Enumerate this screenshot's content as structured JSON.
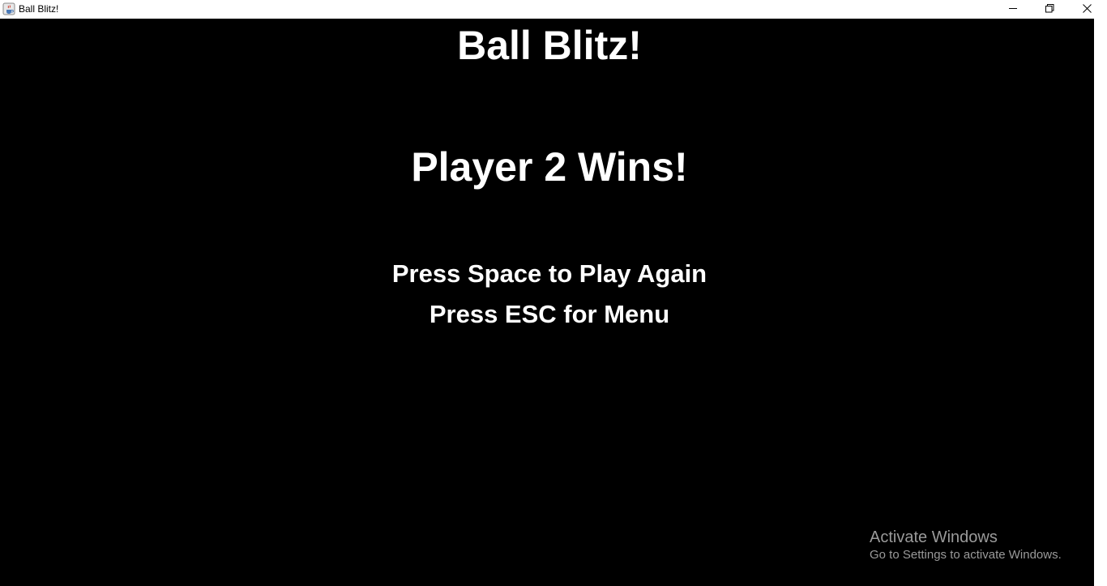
{
  "window": {
    "title": "Ball Blitz!",
    "icon": "java-cup-icon",
    "controls": [
      "minimize-icon",
      "restore-icon",
      "close-icon"
    ]
  },
  "game": {
    "title": "Ball Blitz!",
    "result": "Player 2 Wins!",
    "prompt_play_again": "Press Space to Play Again",
    "prompt_menu": "Press ESC for Menu"
  },
  "watermark": {
    "title": "Activate Windows",
    "subtitle": "Go to Settings to activate Windows."
  },
  "colors": {
    "background": "#000000",
    "text": "#ffffff",
    "watermark": "#9a9a9a"
  }
}
